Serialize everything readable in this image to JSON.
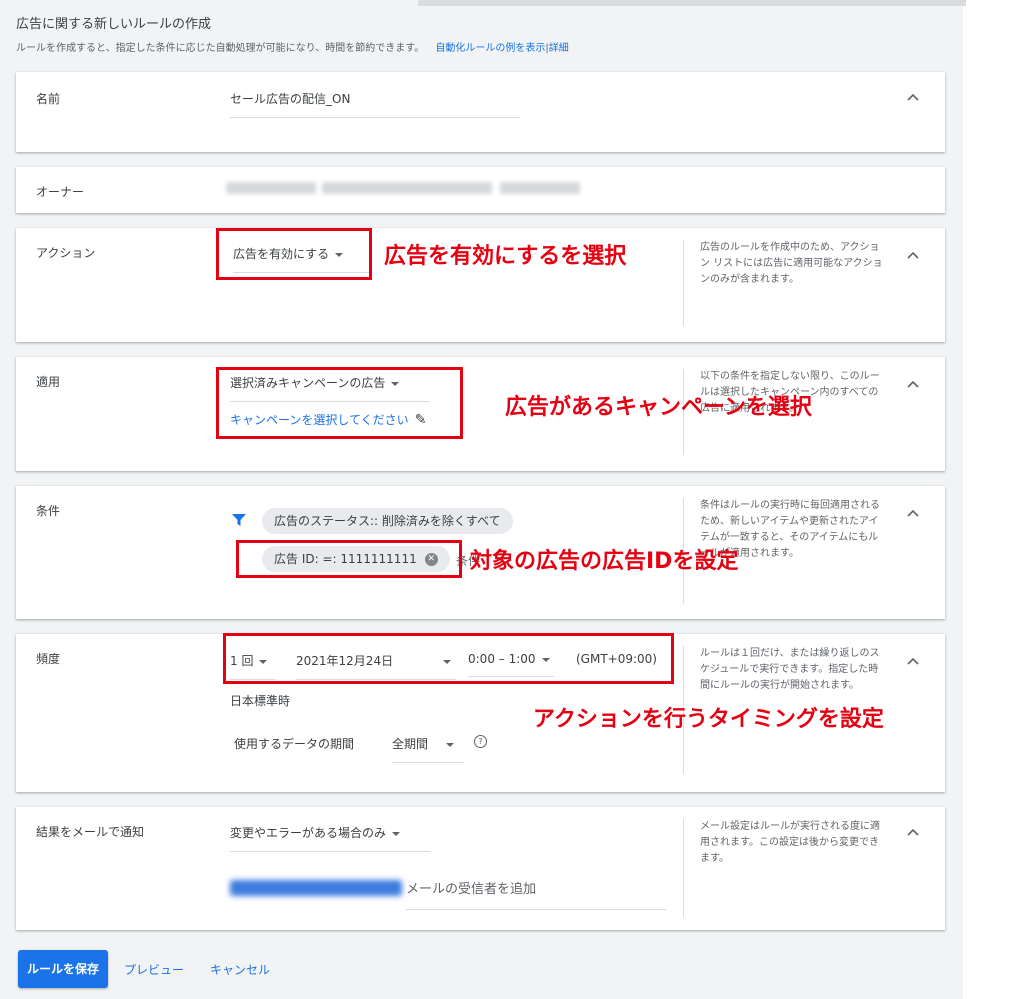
{
  "header": {
    "title": "広告に関する新しいルールの作成",
    "subtitle": "ルールを作成すると、指定した条件に応じた自動処理が可能になり、時間を節約できます。",
    "example_link": "自動化ルールの例を表示",
    "separator": "|",
    "details_link": "詳細"
  },
  "name_section": {
    "label": "名前",
    "value": "セール広告の配信_ON"
  },
  "owner_section": {
    "label": "オーナー"
  },
  "action_section": {
    "label": "アクション",
    "dropdown": "広告を有効にする",
    "help": "広告のルールを作成中のため、アクション リストには広告に適用可能なアクションのみが含まれます。"
  },
  "apply_section": {
    "label": "適用",
    "dropdown": "選択済みキャンペーンの広告",
    "select_link": "キャンペーンを選択してください",
    "help": "以下の条件を指定しない限り、このルールは選択したキャンペーン内のすべての広告に適用されます。"
  },
  "condition_section": {
    "label": "条件",
    "chip_status": "広告のステータス:: 削除済みを除くすべて",
    "chip_id": "広告 ID: =: 1111111111",
    "add_text": "条件",
    "help": "条件はルールの実行時に毎回適用されるため、新しいアイテムや更新されたアイテムが一致すると、そのアイテムにもルールが適用されます。"
  },
  "frequency_section": {
    "label": "頻度",
    "count": "1 回",
    "date": "2021年12月24日",
    "time": "0:00 – 1:00",
    "timezone": "(GMT+09:00)",
    "tz_name": "日本標準時",
    "data_period_label": "使用するデータの期間",
    "data_period_value": "全期間",
    "help": "ルールは１回だけ、または繰り返しのスケジュールで実行できます。指定した時間にルールの実行が開始されます。"
  },
  "email_section": {
    "label": "結果をメールで通知",
    "dropdown": "変更やエラーがある場合のみ",
    "recipient_placeholder": "メールの受信者を追加",
    "help": "メール設定はルールが実行される度に適用されます。この設定は後から変更できます。"
  },
  "footer": {
    "save": "ルールを保存",
    "preview": "プレビュー",
    "cancel": "キャンセル"
  },
  "annotations": {
    "action": "広告を有効にするを選択",
    "apply": "広告があるキャンペーンを選択",
    "condition": "対象の広告の広告IDを設定",
    "frequency": "アクションを行うタイミングを設定"
  },
  "colors": {
    "accent": "#1a73e8",
    "annotation": "#e50012"
  }
}
